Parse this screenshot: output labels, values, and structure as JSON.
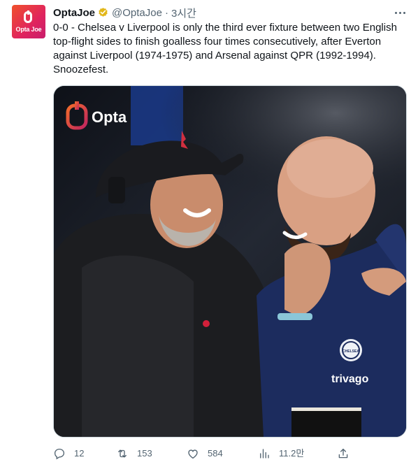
{
  "tweet": {
    "avatar_text": "Opta Joe",
    "display_name": "OptaJoe",
    "handle": "@OptaJoe",
    "separator": "·",
    "time": "3시간",
    "text": "0-0 - Chelsea v Liverpool is only the third ever fixture between two English top-flight sides to finish goalless four times consecutively, after Everton against Liverpool (1974-1975) and Arsenal against QPR (1992-1994). Snoozefest.",
    "media": {
      "watermark": "Opta",
      "sponsor_text": "trivago",
      "crest_text": "CHELSEA"
    }
  },
  "actions": {
    "reply_count": "12",
    "retweet_count": "153",
    "like_count": "584",
    "views_count": "11.2만"
  },
  "colors": {
    "verified_badge": "#e2b719",
    "text_primary": "#0f1419",
    "text_secondary": "#536471",
    "opta_accent": "#f0512b"
  },
  "icons": [
    "more-icon",
    "verified-icon",
    "reply-icon",
    "retweet-icon",
    "like-icon",
    "views-icon",
    "share-icon"
  ]
}
